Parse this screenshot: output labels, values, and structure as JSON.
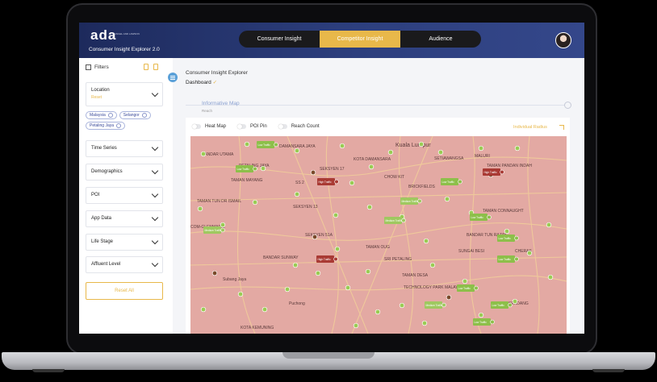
{
  "header": {
    "logo": "ada",
    "logo_sub": "ANGEL AND LAWSON",
    "app_title": "Consumer Insight Explorer 2.0",
    "tabs": [
      {
        "label": "Consumer Insight",
        "active": false
      },
      {
        "label": "Competitor Insight",
        "active": true
      },
      {
        "label": "Audience",
        "active": false
      }
    ]
  },
  "sidebar": {
    "title": "Filters",
    "location": {
      "label": "Location",
      "value": "Reset"
    },
    "chips": [
      "Malaysia",
      "Selangor",
      "Petaling Jaya"
    ],
    "dropdowns": [
      "Time Series",
      "Demographics",
      "POI",
      "App Data",
      "Life Stage",
      "Affluent Level"
    ],
    "reset_label": "Reset All"
  },
  "main": {
    "breadcrumb": "Consumer Insight Explorer",
    "page": "Dashboard",
    "page_mark": "✓",
    "section_title": "Informative Map",
    "section_sub": "Reach",
    "toggles": [
      "Heat Map",
      "POI Pin",
      "Reach Count"
    ],
    "radius_label": "Individual Radius"
  },
  "map": {
    "labels": [
      "Kuala Lumpur",
      "DAMANSARA JAYA",
      "PETALING JAYA",
      "SEKSYEN 17",
      "BANDAR UTAMA",
      "TAMAN MAYANG",
      "SS 2",
      "KOTA DAMANSARA",
      "SEKSYEN 13",
      "SETIAWANGSA",
      "CHOW KIT",
      "BRICKFIELDS",
      "MALURI",
      "TAMAN PANDAN INDAH",
      "TAMAN CONNAUGHT",
      "CHERAS",
      "SUNGAI BESI",
      "TAMAN DESA",
      "BANDAR SUNWAY",
      "Subang Jaya",
      "Puchong",
      "TAMAN OUG",
      "TECHNOLOGY PARK MALAYSIA",
      "SERDANG",
      "TAMAN TUN DR ISMAIL",
      "SRI PETALING",
      "SEKSYEN 51A",
      "COM-GLENMARIE",
      "BANDAR TUN RAZAK",
      "KOTA KEMUNING"
    ],
    "tags": [
      {
        "kind": "low",
        "text": "Low Traffic"
      },
      {
        "kind": "low",
        "text": "Low Traffic"
      },
      {
        "kind": "high",
        "text": "High Traffic"
      },
      {
        "kind": "medium",
        "text": "Medium Traffic"
      },
      {
        "kind": "high",
        "text": "High Traffic"
      },
      {
        "kind": "high",
        "text": "High Traffic"
      },
      {
        "kind": "low",
        "text": "Low Traffic"
      },
      {
        "kind": "medium",
        "text": "Medium Traffic"
      },
      {
        "kind": "low",
        "text": "Low Traffic"
      },
      {
        "kind": "medium",
        "text": "Medium Traffic"
      },
      {
        "kind": "low",
        "text": "Low Traffic"
      },
      {
        "kind": "low",
        "text": "Low Traffic"
      },
      {
        "kind": "low",
        "text": "Low Traffic"
      },
      {
        "kind": "medium",
        "text": "Medium Traffic"
      },
      {
        "kind": "low",
        "text": "Low Traffic"
      },
      {
        "kind": "low",
        "text": "Low Traffic"
      }
    ],
    "colors": {
      "overlay": "#e0a5a0",
      "low": "#8dbf4a",
      "high": "#a93a34",
      "medium": "#9fc860"
    }
  }
}
